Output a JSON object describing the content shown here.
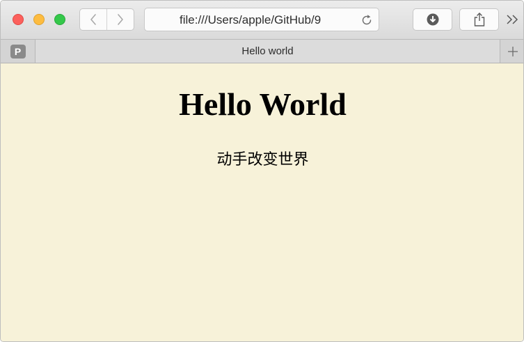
{
  "window": {
    "address_url": "file:///Users/apple/GitHub/9",
    "pinned_tab_letter": "P",
    "active_tab_title": "Hello world",
    "overflow_glyph": "»"
  },
  "icons": {
    "back": "chevron-left-icon",
    "forward": "chevron-right-icon",
    "reload": "reload-icon",
    "download": "download-icon",
    "share": "share-icon",
    "new_tab": "plus-icon"
  },
  "page": {
    "heading": "Hello World",
    "subtitle": "动手改变世界"
  },
  "colors": {
    "page_background": "#f7f2d9",
    "close": "#fc605c",
    "minimize": "#fdbc40",
    "maximize": "#34c84a"
  }
}
